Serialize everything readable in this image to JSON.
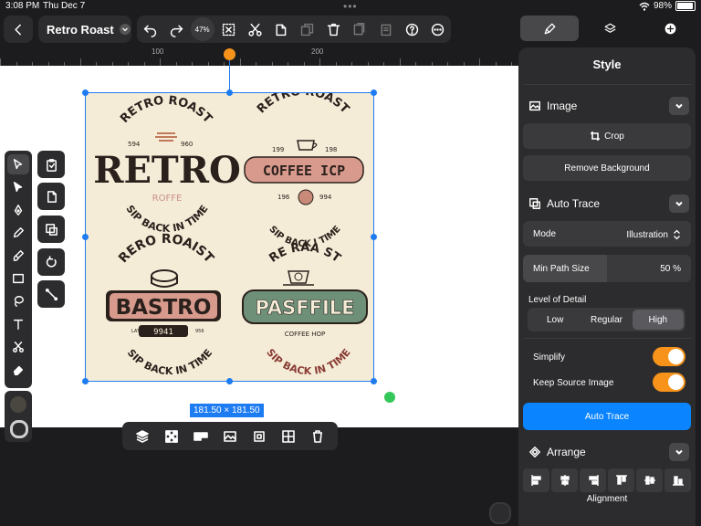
{
  "status": {
    "time": "3:08 PM",
    "date": "Thu Dec 7",
    "battery": "98%"
  },
  "toolbar": {
    "back_icon": "chevron-left-icon",
    "document_title": "Retro Roast",
    "zoom": "47%",
    "items": [
      "undo-icon",
      "redo-icon",
      "zoom-control",
      "transform-icon",
      "scissors-icon",
      "paste-icon",
      "duplicate-icon",
      "delete-icon",
      "copy-style-icon",
      "paste-style-icon",
      "help-icon",
      "more-icon"
    ]
  },
  "ruler": {
    "labels": [
      "100",
      "200"
    ]
  },
  "canvas": {
    "selection_size": "181.50 × 181.50",
    "artwork": {
      "badge1": {
        "top": "RETRO ROAST",
        "num_left": "594",
        "num_right": "960",
        "main": "RETRO",
        "sub": "ROFFE",
        "bottom": "SIP BACK IN TIME"
      },
      "badge2": {
        "top": "RETRO ROAST",
        "num_left": "199",
        "num_right": "198",
        "main": "COFFEE ICP",
        "num2_left": "196",
        "num2_right": "994",
        "bottom": "SIP BACK I TIME"
      },
      "badge3": {
        "top": "RERO ROAIST",
        "main": "BASTRO",
        "numbers": "9941",
        "small_left": "LAT",
        "small_right": "956",
        "bottom": "SIP BACK IN TIME"
      },
      "badge4": {
        "top": "RE RAA ST",
        "main": "PASFFILE",
        "sub": "COFFEE HOP",
        "bottom": "SIP BACK IN TIME"
      }
    }
  },
  "colors": {
    "accent": "#1e7cf2",
    "orange": "#f7931a",
    "green": "#34c759",
    "artwork_bg": "#f5ecd8",
    "dark_brown": "#2b211c",
    "pink": "#d99a8e",
    "sage": "#6e8f78"
  },
  "right_tabs": [
    "brush-icon",
    "layers-icon",
    "add-icon"
  ],
  "panel": {
    "title": "Style",
    "image": {
      "label": "Image",
      "crop_label": "Crop",
      "remove_bg_label": "Remove Background"
    },
    "auto_trace": {
      "label": "Auto Trace",
      "mode_label": "Mode",
      "mode_value": "Illustration",
      "min_path_label": "Min Path Size",
      "min_path_value": "50 %",
      "lod_label": "Level of Detail",
      "lod_options": [
        "Low",
        "Regular",
        "High"
      ],
      "lod_selected": "High",
      "simplify_label": "Simplify",
      "simplify_on": true,
      "keep_source_label": "Keep Source Image",
      "keep_source_on": true,
      "button_label": "Auto Trace"
    },
    "arrange": {
      "label": "Arrange",
      "alignment_label": "Alignment"
    }
  }
}
